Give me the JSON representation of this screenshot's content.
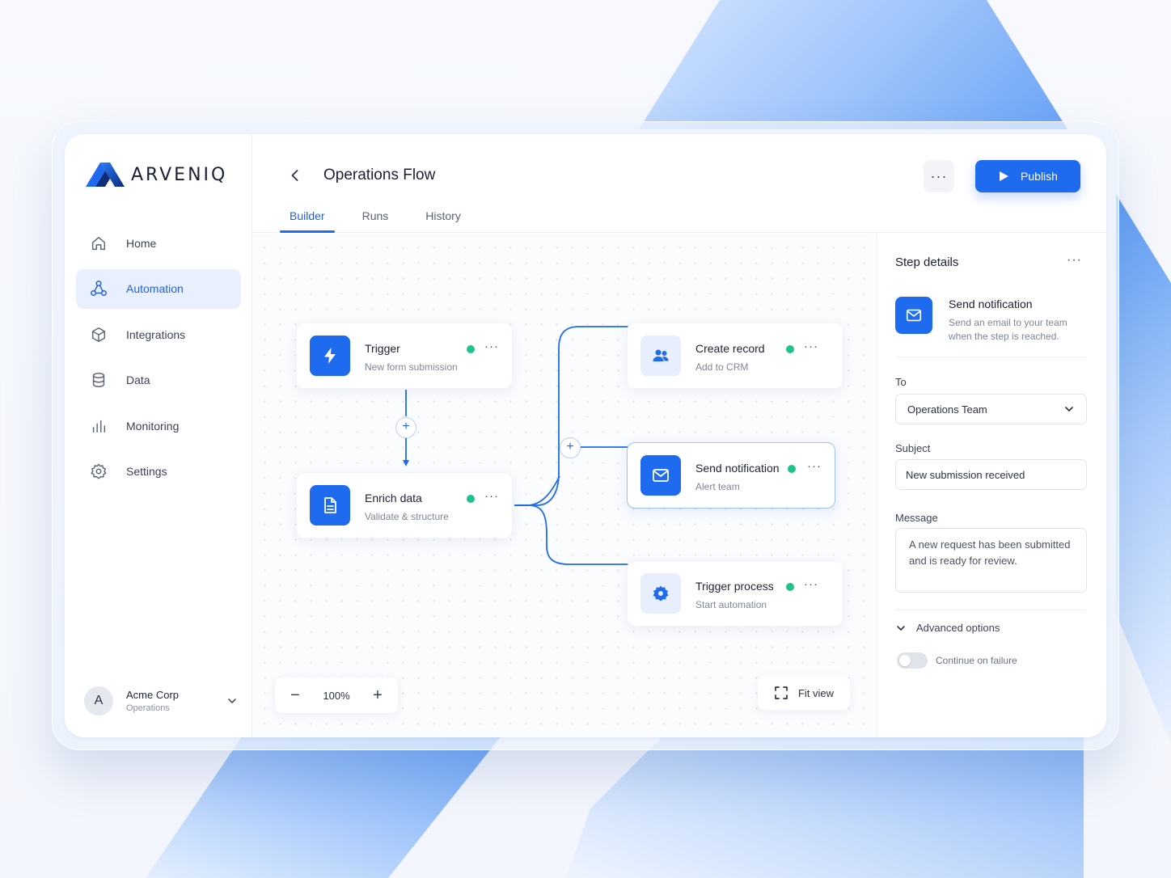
{
  "brand": {
    "name": "ARVENIQ"
  },
  "colors": {
    "accent": "#1f6bf0",
    "status_active": "#1ec28b"
  },
  "sidebar": {
    "items": [
      {
        "label": "Home",
        "icon": "home-icon"
      },
      {
        "label": "Automation",
        "icon": "workflow-icon",
        "active": true
      },
      {
        "label": "Integrations",
        "icon": "cube-icon"
      },
      {
        "label": "Data",
        "icon": "database-icon"
      },
      {
        "label": "Monitoring",
        "icon": "bar-chart-icon"
      },
      {
        "label": "Settings",
        "icon": "gear-icon"
      }
    ],
    "org": {
      "initial": "A",
      "name": "Acme Corp",
      "team": "Operations"
    }
  },
  "header": {
    "title": "Operations Flow",
    "more": "···",
    "publish_label": "Publish",
    "tabs": [
      {
        "label": "Builder",
        "active": true
      },
      {
        "label": "Runs"
      },
      {
        "label": "History"
      }
    ]
  },
  "canvas": {
    "nodes": {
      "trigger": {
        "title": "Trigger",
        "subtitle": "New form submission",
        "icon": "lightning-icon"
      },
      "enrich": {
        "title": "Enrich data",
        "subtitle": "Validate & structure",
        "icon": "document-icon"
      },
      "create": {
        "title": "Create record",
        "subtitle": "Add to CRM",
        "icon": "users-icon"
      },
      "notify": {
        "title": "Send notification",
        "subtitle": "Alert team",
        "icon": "mail-icon"
      },
      "process": {
        "title": "Trigger process",
        "subtitle": "Start automation",
        "icon": "gear-icon"
      }
    },
    "more": "···",
    "plus": "+",
    "zoom": {
      "value": "100%",
      "minus": "−",
      "plus": "+"
    },
    "fit_label": "Fit view"
  },
  "panel": {
    "title": "Step details",
    "more": "···",
    "step": {
      "name": "Send notification",
      "description": "Send an email to your team when the step is reached."
    },
    "to_label": "To",
    "to_value": "Operations Team",
    "subject_label": "Subject",
    "subject_value": "New submission received",
    "message_label": "Message",
    "message_value": "A new request has been submitted and is ready for review.",
    "advanced_label": "Advanced options",
    "continue_label": "Continue on failure",
    "continue_on_failure": false
  }
}
